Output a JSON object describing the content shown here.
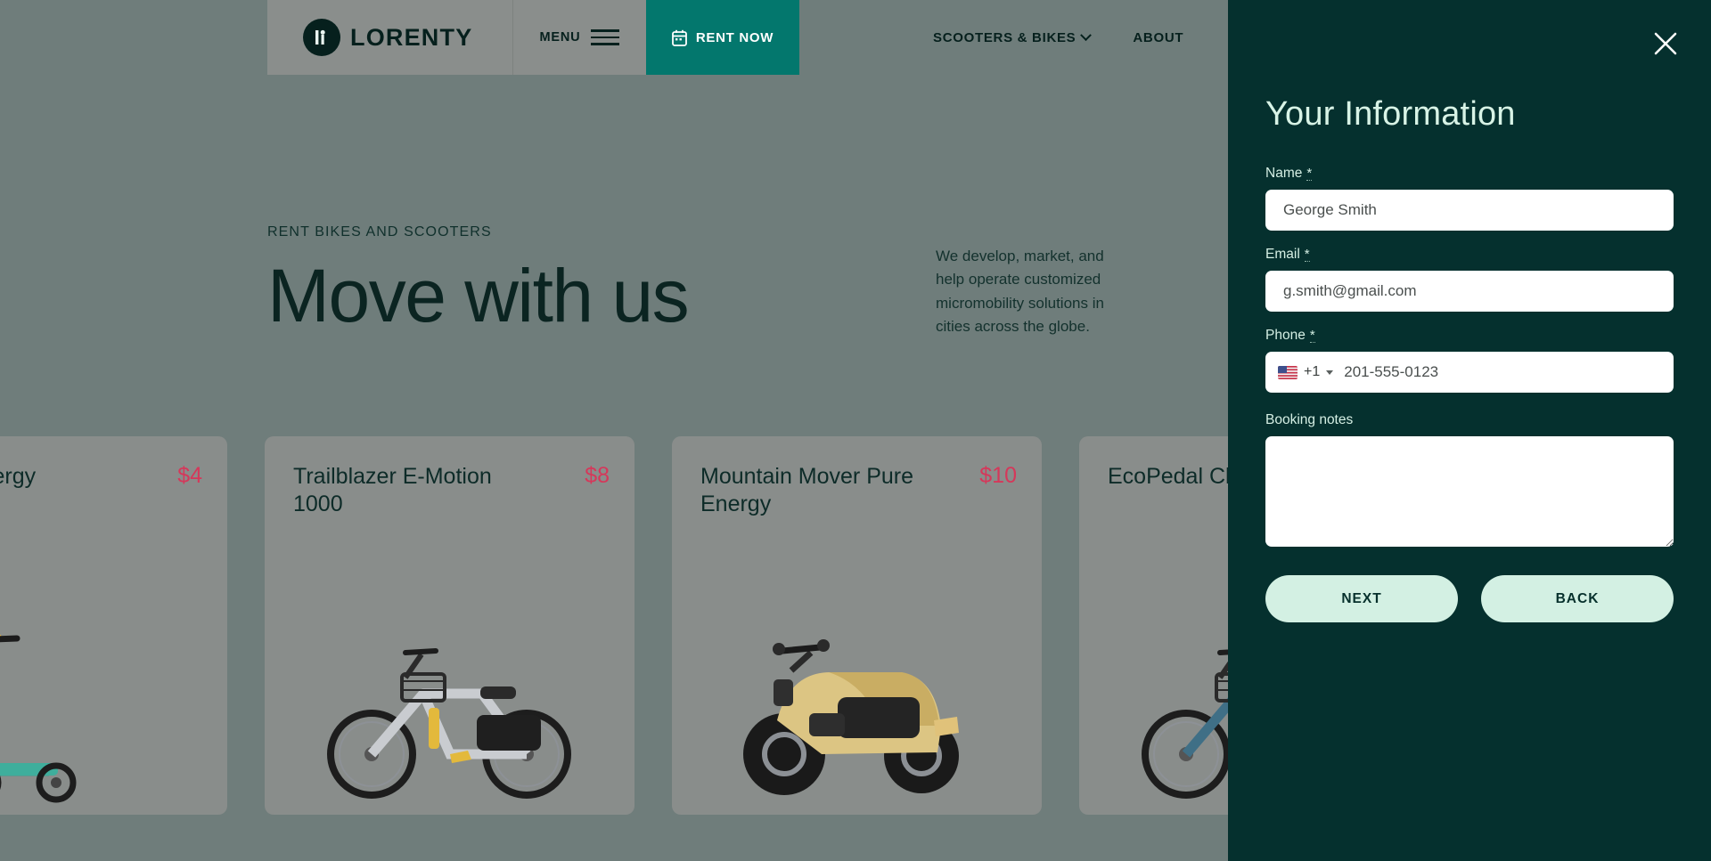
{
  "brand": {
    "name": "LORENTY",
    "logo_icon": "lorenty-circle-logo"
  },
  "header": {
    "menu_label": "MENU",
    "menu_icon": "hamburger-icon",
    "rent_now_label": "RENT NOW",
    "rent_now_icon": "calendar-icon",
    "nav_links": [
      {
        "label": "SCOOTERS & BIKES",
        "has_dropdown": true
      },
      {
        "label": "ABOUT",
        "has_dropdown": false
      }
    ],
    "accent_color": "#03776d"
  },
  "hero": {
    "eyebrow": "RENT BIKES AND SCOOTERS",
    "title": "Move with us",
    "paragraph": "We develop, market, and help operate customized micromobility solutions in cities across the globe."
  },
  "products": [
    {
      "name": "er Pure Energy",
      "price": "$4",
      "art": "scooter"
    },
    {
      "name": "Trailblazer E-Motion 1000",
      "price": "$8",
      "art": "ebike"
    },
    {
      "name": "Mountain Mover Pure Energy",
      "price": "$10",
      "art": "moped"
    },
    {
      "name": "EcoPedal Cl",
      "price": "",
      "art": "ebike"
    }
  ],
  "panel": {
    "title": "Your Information",
    "close_icon": "close-icon",
    "background_color": "#05302e",
    "fields": {
      "name": {
        "label": "Name",
        "required_marker": "*",
        "value": "George Smith",
        "placeholder": "George Smith"
      },
      "email": {
        "label": "Email",
        "required_marker": "*",
        "value": "g.smith@gmail.com",
        "placeholder": "g.smith@gmail.com"
      },
      "phone": {
        "label": "Phone",
        "required_marker": "*",
        "country_flag": "us-flag-icon",
        "dial_code": "+1",
        "value": "201-555-0123",
        "placeholder": "201-555-0123"
      },
      "notes": {
        "label": "Booking notes",
        "value": "",
        "placeholder": ""
      }
    },
    "buttons": {
      "next": "NEXT",
      "back": "BACK",
      "color": "#d3f0e3"
    }
  }
}
